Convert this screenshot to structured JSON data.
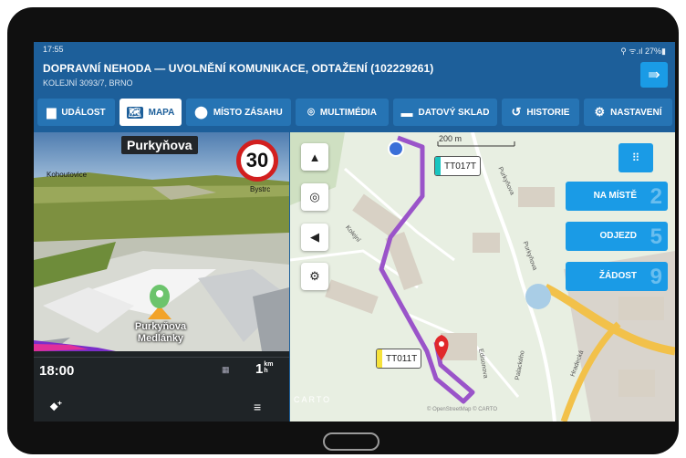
{
  "status_bar": {
    "time": "17:55",
    "system": "⚲ ᯤ.ıl 27%▮"
  },
  "header": {
    "title": "DOPRAVNÍ NEHODA — UVOLNĚNÍ KOMUNIKACE, ODTAŽENÍ (102229261)",
    "subtitle": "KOLEJNÍ 3093/7, BRNO",
    "logout_icon": "logout-arrow-icon"
  },
  "tabs": [
    {
      "label": "UDÁLOST",
      "icon": "document-icon"
    },
    {
      "label": "MAPA",
      "icon": "map-icon"
    },
    {
      "label": "MÍSTO ZÁSAHU",
      "icon": "location-pin-icon"
    },
    {
      "label": "MULTIMÉDIA",
      "icon": "camera-scan-icon"
    },
    {
      "label": "DATOVÝ SKLAD",
      "icon": "folder-icon"
    },
    {
      "label": "HISTORIE",
      "icon": "history-icon"
    },
    {
      "label": "NASTAVENÍ",
      "icon": "gear-icon"
    }
  ],
  "navigation": {
    "street": "Purkyňova",
    "speed_limit": "30",
    "place_left": "Kohoutovice",
    "place_right": "Bystrc",
    "destination_line1": "Purkyňova",
    "destination_line2": "Medlánky",
    "arrival_time": "18:00",
    "distance_value": "1",
    "distance_unit_top": "km",
    "distance_unit_bottom": "h"
  },
  "map": {
    "scale_label": "200 m",
    "vehicle_1": "TT017T",
    "vehicle_2": "TT011T",
    "streets": [
      "Purkyňova",
      "Purkyňova",
      "Kolejní",
      "Edisonova",
      "Hradecká",
      "Palackého"
    ],
    "watermark": "CARTO",
    "attribution": "© OpenStreetMap © CARTO"
  },
  "actions": [
    {
      "label": "NA MÍSTĚ",
      "count": "2"
    },
    {
      "label": "ODJEZD",
      "count": "5"
    },
    {
      "label": "ŽÁDOST",
      "count": "9"
    }
  ],
  "colors": {
    "brand": "#1d5f9a",
    "accent": "#1a9be6",
    "route": "#9a54c9"
  }
}
